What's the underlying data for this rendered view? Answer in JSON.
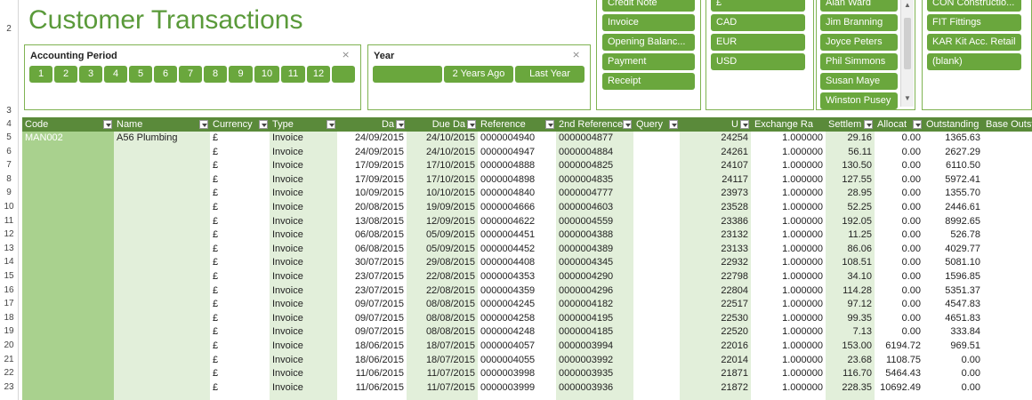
{
  "title": "Customer Transactions",
  "row_numbers": [
    "2",
    "3",
    "4",
    "5",
    "6",
    "7",
    "8",
    "9",
    "10",
    "11",
    "12",
    "13",
    "14",
    "15",
    "16",
    "17",
    "18",
    "19",
    "20",
    "21",
    "22",
    "23"
  ],
  "slicers": {
    "accounting_period": {
      "title": "Accounting Period",
      "items": [
        "1",
        "2",
        "3",
        "4",
        "5",
        "6",
        "7",
        "8",
        "9",
        "10",
        "11",
        "12",
        ""
      ]
    },
    "year": {
      "title": "Year",
      "items": [
        "",
        "2 Years Ago",
        "Last Year"
      ]
    },
    "type": {
      "items": [
        "Credit Note",
        "Invoice",
        "Opening Balanc...",
        "Payment",
        "Receipt"
      ]
    },
    "currency": {
      "items": [
        "£",
        "CAD",
        "EUR",
        "USD"
      ]
    },
    "person": {
      "items": [
        "Alan Ward",
        "Jim Branning",
        "Joyce Peters",
        "Phil Simmons",
        "Susan Maye",
        "Winston Pusey"
      ]
    },
    "customer": {
      "items": [
        "CON Constructio...",
        "FIT Fittings",
        "KAR Kit Acc. Retail",
        "(blank)"
      ]
    }
  },
  "columns": [
    "Code",
    "Name",
    "Currency",
    "Type",
    "Da",
    "Due Da",
    "Reference",
    "2nd Reference",
    "Query",
    "U",
    "Exchange Ra",
    "Settlem",
    "Allocat",
    "Outstanding",
    "Base Outst"
  ],
  "first_row": {
    "code": "MAN002",
    "name": "A56 Plumbing"
  },
  "rows": [
    [
      "£",
      "Invoice",
      "24/09/2015",
      "24/10/2015",
      "0000004940",
      "0000004877",
      "24254",
      "1.000000",
      "29.16",
      "0.00",
      "1365.63"
    ],
    [
      "£",
      "Invoice",
      "24/09/2015",
      "24/10/2015",
      "0000004947",
      "0000004884",
      "24261",
      "1.000000",
      "56.11",
      "0.00",
      "2627.29"
    ],
    [
      "£",
      "Invoice",
      "17/09/2015",
      "17/10/2015",
      "0000004888",
      "0000004825",
      "24107",
      "1.000000",
      "130.50",
      "0.00",
      "6110.50"
    ],
    [
      "£",
      "Invoice",
      "17/09/2015",
      "17/10/2015",
      "0000004898",
      "0000004835",
      "24117",
      "1.000000",
      "127.55",
      "0.00",
      "5972.41"
    ],
    [
      "£",
      "Invoice",
      "10/09/2015",
      "10/10/2015",
      "0000004840",
      "0000004777",
      "23973",
      "1.000000",
      "28.95",
      "0.00",
      "1355.70"
    ],
    [
      "£",
      "Invoice",
      "20/08/2015",
      "19/09/2015",
      "0000004666",
      "0000004603",
      "23528",
      "1.000000",
      "52.25",
      "0.00",
      "2446.61"
    ],
    [
      "£",
      "Invoice",
      "13/08/2015",
      "12/09/2015",
      "0000004622",
      "0000004559",
      "23386",
      "1.000000",
      "192.05",
      "0.00",
      "8992.65"
    ],
    [
      "£",
      "Invoice",
      "06/08/2015",
      "05/09/2015",
      "0000004451",
      "0000004388",
      "23132",
      "1.000000",
      "11.25",
      "0.00",
      "526.78"
    ],
    [
      "£",
      "Invoice",
      "06/08/2015",
      "05/09/2015",
      "0000004452",
      "0000004389",
      "23133",
      "1.000000",
      "86.06",
      "0.00",
      "4029.77"
    ],
    [
      "£",
      "Invoice",
      "30/07/2015",
      "29/08/2015",
      "0000004408",
      "0000004345",
      "22932",
      "1.000000",
      "108.51",
      "0.00",
      "5081.10"
    ],
    [
      "£",
      "Invoice",
      "23/07/2015",
      "22/08/2015",
      "0000004353",
      "0000004290",
      "22798",
      "1.000000",
      "34.10",
      "0.00",
      "1596.85"
    ],
    [
      "£",
      "Invoice",
      "23/07/2015",
      "22/08/2015",
      "0000004359",
      "0000004296",
      "22804",
      "1.000000",
      "114.28",
      "0.00",
      "5351.37"
    ],
    [
      "£",
      "Invoice",
      "09/07/2015",
      "08/08/2015",
      "0000004245",
      "0000004182",
      "22517",
      "1.000000",
      "97.12",
      "0.00",
      "4547.83"
    ],
    [
      "£",
      "Invoice",
      "09/07/2015",
      "08/08/2015",
      "0000004258",
      "0000004195",
      "22530",
      "1.000000",
      "99.35",
      "0.00",
      "4651.83"
    ],
    [
      "£",
      "Invoice",
      "09/07/2015",
      "08/08/2015",
      "0000004248",
      "0000004185",
      "22520",
      "1.000000",
      "7.13",
      "0.00",
      "333.84"
    ],
    [
      "£",
      "Invoice",
      "18/06/2015",
      "18/07/2015",
      "0000004057",
      "0000003994",
      "22016",
      "1.000000",
      "153.00",
      "6194.72",
      "969.51"
    ],
    [
      "£",
      "Invoice",
      "18/06/2015",
      "18/07/2015",
      "0000004055",
      "0000003992",
      "22014",
      "1.000000",
      "23.68",
      "1108.75",
      "0.00"
    ],
    [
      "£",
      "Invoice",
      "11/06/2015",
      "11/07/2015",
      "0000003998",
      "0000003935",
      "21871",
      "1.000000",
      "116.70",
      "5464.43",
      "0.00"
    ],
    [
      "£",
      "Invoice",
      "11/06/2015",
      "11/07/2015",
      "0000003999",
      "0000003936",
      "21872",
      "1.000000",
      "228.35",
      "10692.49",
      "0.00"
    ]
  ]
}
